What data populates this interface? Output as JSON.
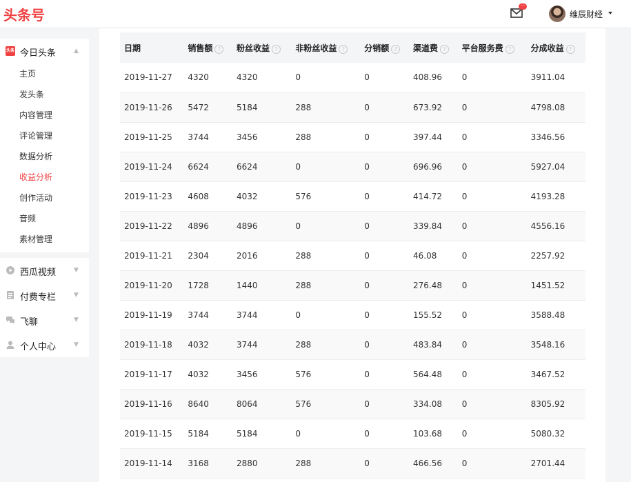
{
  "header": {
    "logo": "头条号",
    "mail_badge": "···",
    "username": "维辰财经"
  },
  "sidebar": {
    "toutiao": {
      "badge": "头条",
      "label": "今日头条",
      "items": [
        {
          "label": "主页",
          "active": false
        },
        {
          "label": "发头条",
          "active": false
        },
        {
          "label": "内容管理",
          "active": false
        },
        {
          "label": "评论管理",
          "active": false
        },
        {
          "label": "数据分析",
          "active": false
        },
        {
          "label": "收益分析",
          "active": true
        },
        {
          "label": "创作活动",
          "active": false
        },
        {
          "label": "音频",
          "active": false
        },
        {
          "label": "素材管理",
          "active": false
        }
      ]
    },
    "groups": [
      {
        "label": "西瓜视频",
        "icon": "play-circle-icon"
      },
      {
        "label": "付费专栏",
        "icon": "document-icon"
      },
      {
        "label": "飞聊",
        "icon": "chat-icon"
      },
      {
        "label": "个人中心",
        "icon": "user-icon"
      }
    ]
  },
  "table": {
    "columns": [
      {
        "label": "日期",
        "help": false
      },
      {
        "label": "销售额",
        "help": true
      },
      {
        "label": "粉丝收益",
        "help": true
      },
      {
        "label": "非粉丝收益",
        "help": true
      },
      {
        "label": "分销额",
        "help": true
      },
      {
        "label": "渠道费",
        "help": true
      },
      {
        "label": "平台服务费",
        "help": true
      },
      {
        "label": "分成收益",
        "help": true
      }
    ],
    "rows": [
      [
        "2019-11-27",
        "4320",
        "4320",
        "0",
        "0",
        "408.96",
        "0",
        "3911.04"
      ],
      [
        "2019-11-26",
        "5472",
        "5184",
        "288",
        "0",
        "673.92",
        "0",
        "4798.08"
      ],
      [
        "2019-11-25",
        "3744",
        "3456",
        "288",
        "0",
        "397.44",
        "0",
        "3346.56"
      ],
      [
        "2019-11-24",
        "6624",
        "6624",
        "0",
        "0",
        "696.96",
        "0",
        "5927.04"
      ],
      [
        "2019-11-23",
        "4608",
        "4032",
        "576",
        "0",
        "414.72",
        "0",
        "4193.28"
      ],
      [
        "2019-11-22",
        "4896",
        "4896",
        "0",
        "0",
        "339.84",
        "0",
        "4556.16"
      ],
      [
        "2019-11-21",
        "2304",
        "2016",
        "288",
        "0",
        "46.08",
        "0",
        "2257.92"
      ],
      [
        "2019-11-20",
        "1728",
        "1440",
        "288",
        "0",
        "276.48",
        "0",
        "1451.52"
      ],
      [
        "2019-11-19",
        "3744",
        "3744",
        "0",
        "0",
        "155.52",
        "0",
        "3588.48"
      ],
      [
        "2019-11-18",
        "4032",
        "3744",
        "288",
        "0",
        "483.84",
        "0",
        "3548.16"
      ],
      [
        "2019-11-17",
        "4032",
        "3456",
        "576",
        "0",
        "564.48",
        "0",
        "3467.52"
      ],
      [
        "2019-11-16",
        "8640",
        "8064",
        "576",
        "0",
        "334.08",
        "0",
        "8305.92"
      ],
      [
        "2019-11-15",
        "5184",
        "5184",
        "0",
        "0",
        "103.68",
        "0",
        "5080.32"
      ],
      [
        "2019-11-14",
        "3168",
        "2880",
        "288",
        "0",
        "466.56",
        "0",
        "2701.44"
      ]
    ]
  },
  "colors": {
    "brand": "#f04142",
    "page_bg": "#f4f5f6"
  }
}
